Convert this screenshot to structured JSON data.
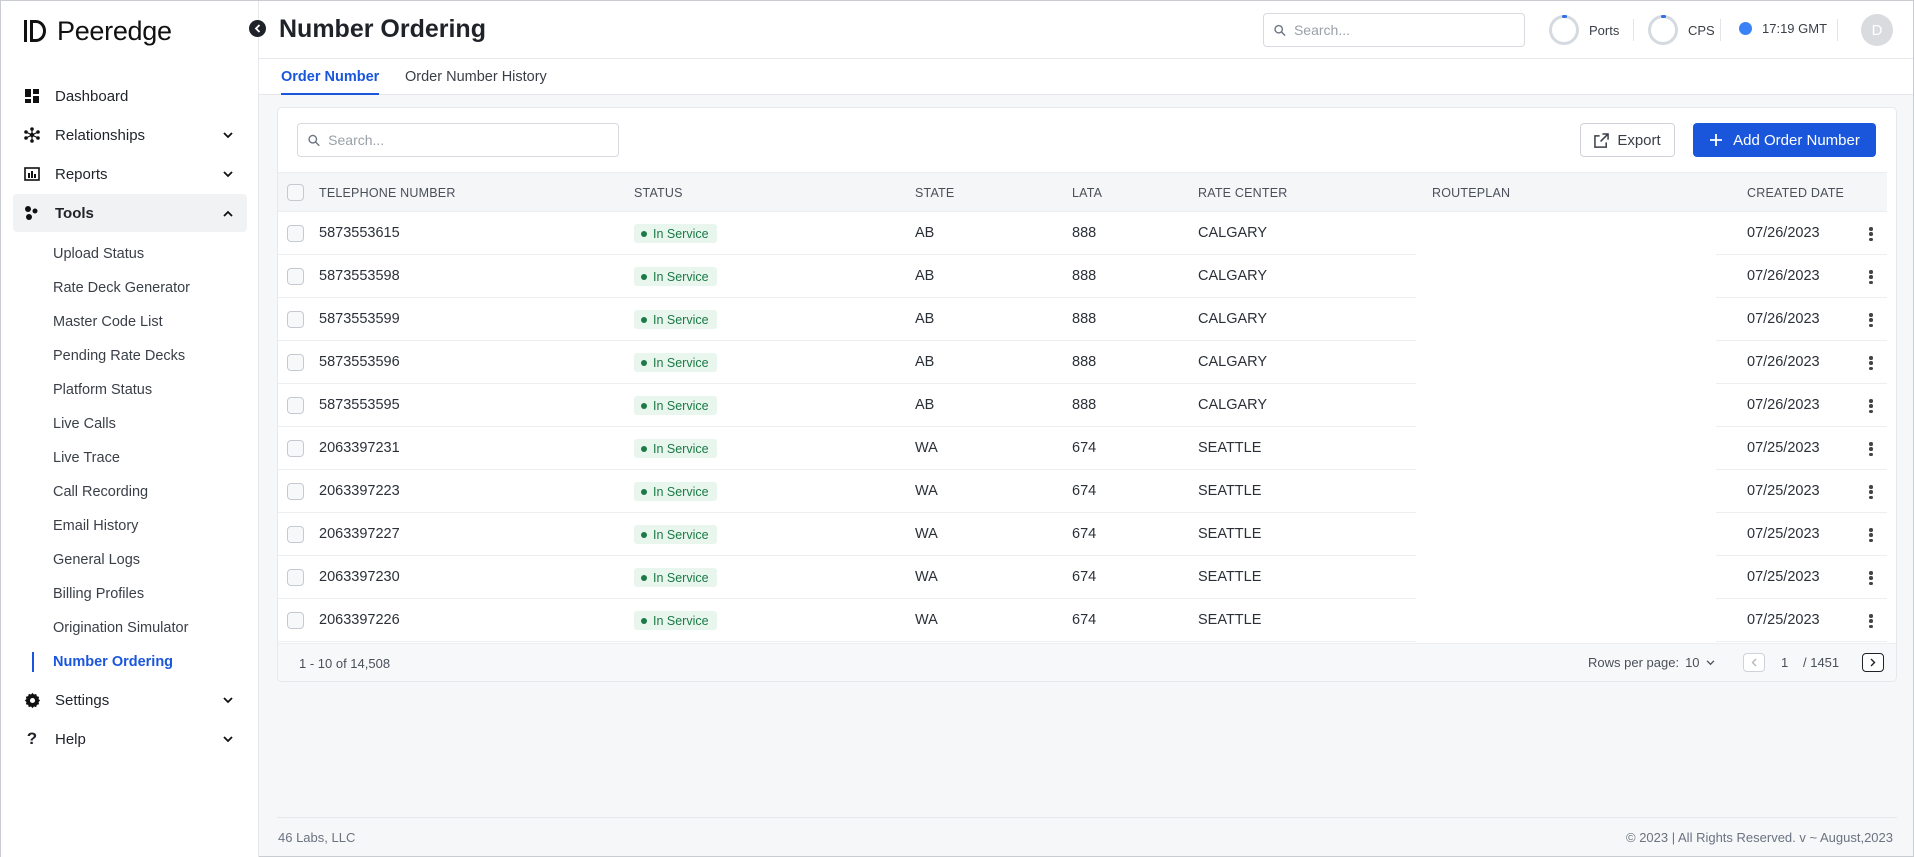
{
  "app": {
    "brand": "Peeredge"
  },
  "sidebar": {
    "items": [
      {
        "label": "Dashboard",
        "icon": "dashboard-icon"
      },
      {
        "label": "Relationships",
        "icon": "relationships-icon"
      },
      {
        "label": "Reports",
        "icon": "reports-icon"
      },
      {
        "label": "Tools",
        "icon": "tools-icon"
      },
      {
        "label": "Settings",
        "icon": "settings-icon"
      },
      {
        "label": "Help",
        "icon": "help-icon"
      }
    ],
    "tools_sub": [
      "Upload Status",
      "Rate Deck Generator",
      "Master Code List",
      "Pending Rate Decks",
      "Platform Status",
      "Live Calls",
      "Live Trace",
      "Call Recording",
      "Email History",
      "General Logs",
      "Billing Profiles",
      "Origination Simulator",
      "Number Ordering"
    ]
  },
  "header": {
    "title": "Number Ordering",
    "search_placeholder": "Search...",
    "ports_label": "Ports",
    "cps_label": "CPS",
    "time": "17:19 GMT",
    "avatar_initial": "D"
  },
  "tabs": [
    "Order Number",
    "Order Number History"
  ],
  "table": {
    "search_placeholder": "Search...",
    "export_label": "Export",
    "add_label": "Add Order Number",
    "columns": [
      "TELEPHONE NUMBER",
      "STATUS",
      "STATE",
      "LATA",
      "RATE CENTER",
      "ROUTEPLAN",
      "CREATED DATE"
    ],
    "rows": [
      {
        "number": "5873553615",
        "status": "In Service",
        "state": "AB",
        "lata": "888",
        "rate_center": "CALGARY",
        "routeplan": "",
        "created": "07/26/2023"
      },
      {
        "number": "5873553598",
        "status": "In Service",
        "state": "AB",
        "lata": "888",
        "rate_center": "CALGARY",
        "routeplan": "",
        "created": "07/26/2023"
      },
      {
        "number": "5873553599",
        "status": "In Service",
        "state": "AB",
        "lata": "888",
        "rate_center": "CALGARY",
        "routeplan": "",
        "created": "07/26/2023"
      },
      {
        "number": "5873553596",
        "status": "In Service",
        "state": "AB",
        "lata": "888",
        "rate_center": "CALGARY",
        "routeplan": "",
        "created": "07/26/2023"
      },
      {
        "number": "5873553595",
        "status": "In Service",
        "state": "AB",
        "lata": "888",
        "rate_center": "CALGARY",
        "routeplan": "",
        "created": "07/26/2023"
      },
      {
        "number": "2063397231",
        "status": "In Service",
        "state": "WA",
        "lata": "674",
        "rate_center": "SEATTLE",
        "routeplan": "",
        "created": "07/25/2023"
      },
      {
        "number": "2063397223",
        "status": "In Service",
        "state": "WA",
        "lata": "674",
        "rate_center": "SEATTLE",
        "routeplan": "",
        "created": "07/25/2023"
      },
      {
        "number": "2063397227",
        "status": "In Service",
        "state": "WA",
        "lata": "674",
        "rate_center": "SEATTLE",
        "routeplan": "",
        "created": "07/25/2023"
      },
      {
        "number": "2063397230",
        "status": "In Service",
        "state": "WA",
        "lata": "674",
        "rate_center": "SEATTLE",
        "routeplan": "",
        "created": "07/25/2023"
      },
      {
        "number": "2063397226",
        "status": "In Service",
        "state": "WA",
        "lata": "674",
        "rate_center": "SEATTLE",
        "routeplan": "",
        "created": "07/25/2023"
      }
    ],
    "range_text": "1 - 10 of 14,508",
    "rows_per_page_label": "Rows per page:",
    "rows_per_page_value": "10",
    "current_page": "1",
    "total_pages": "/ 1451"
  },
  "footer": {
    "left": "46 Labs, LLC",
    "right": "© 2023 | All Rights Reserved. v ~ August,2023"
  },
  "colors": {
    "accent": "#1a56db",
    "status_green": "#1b7a45",
    "status_bg": "#e8f6ee"
  }
}
